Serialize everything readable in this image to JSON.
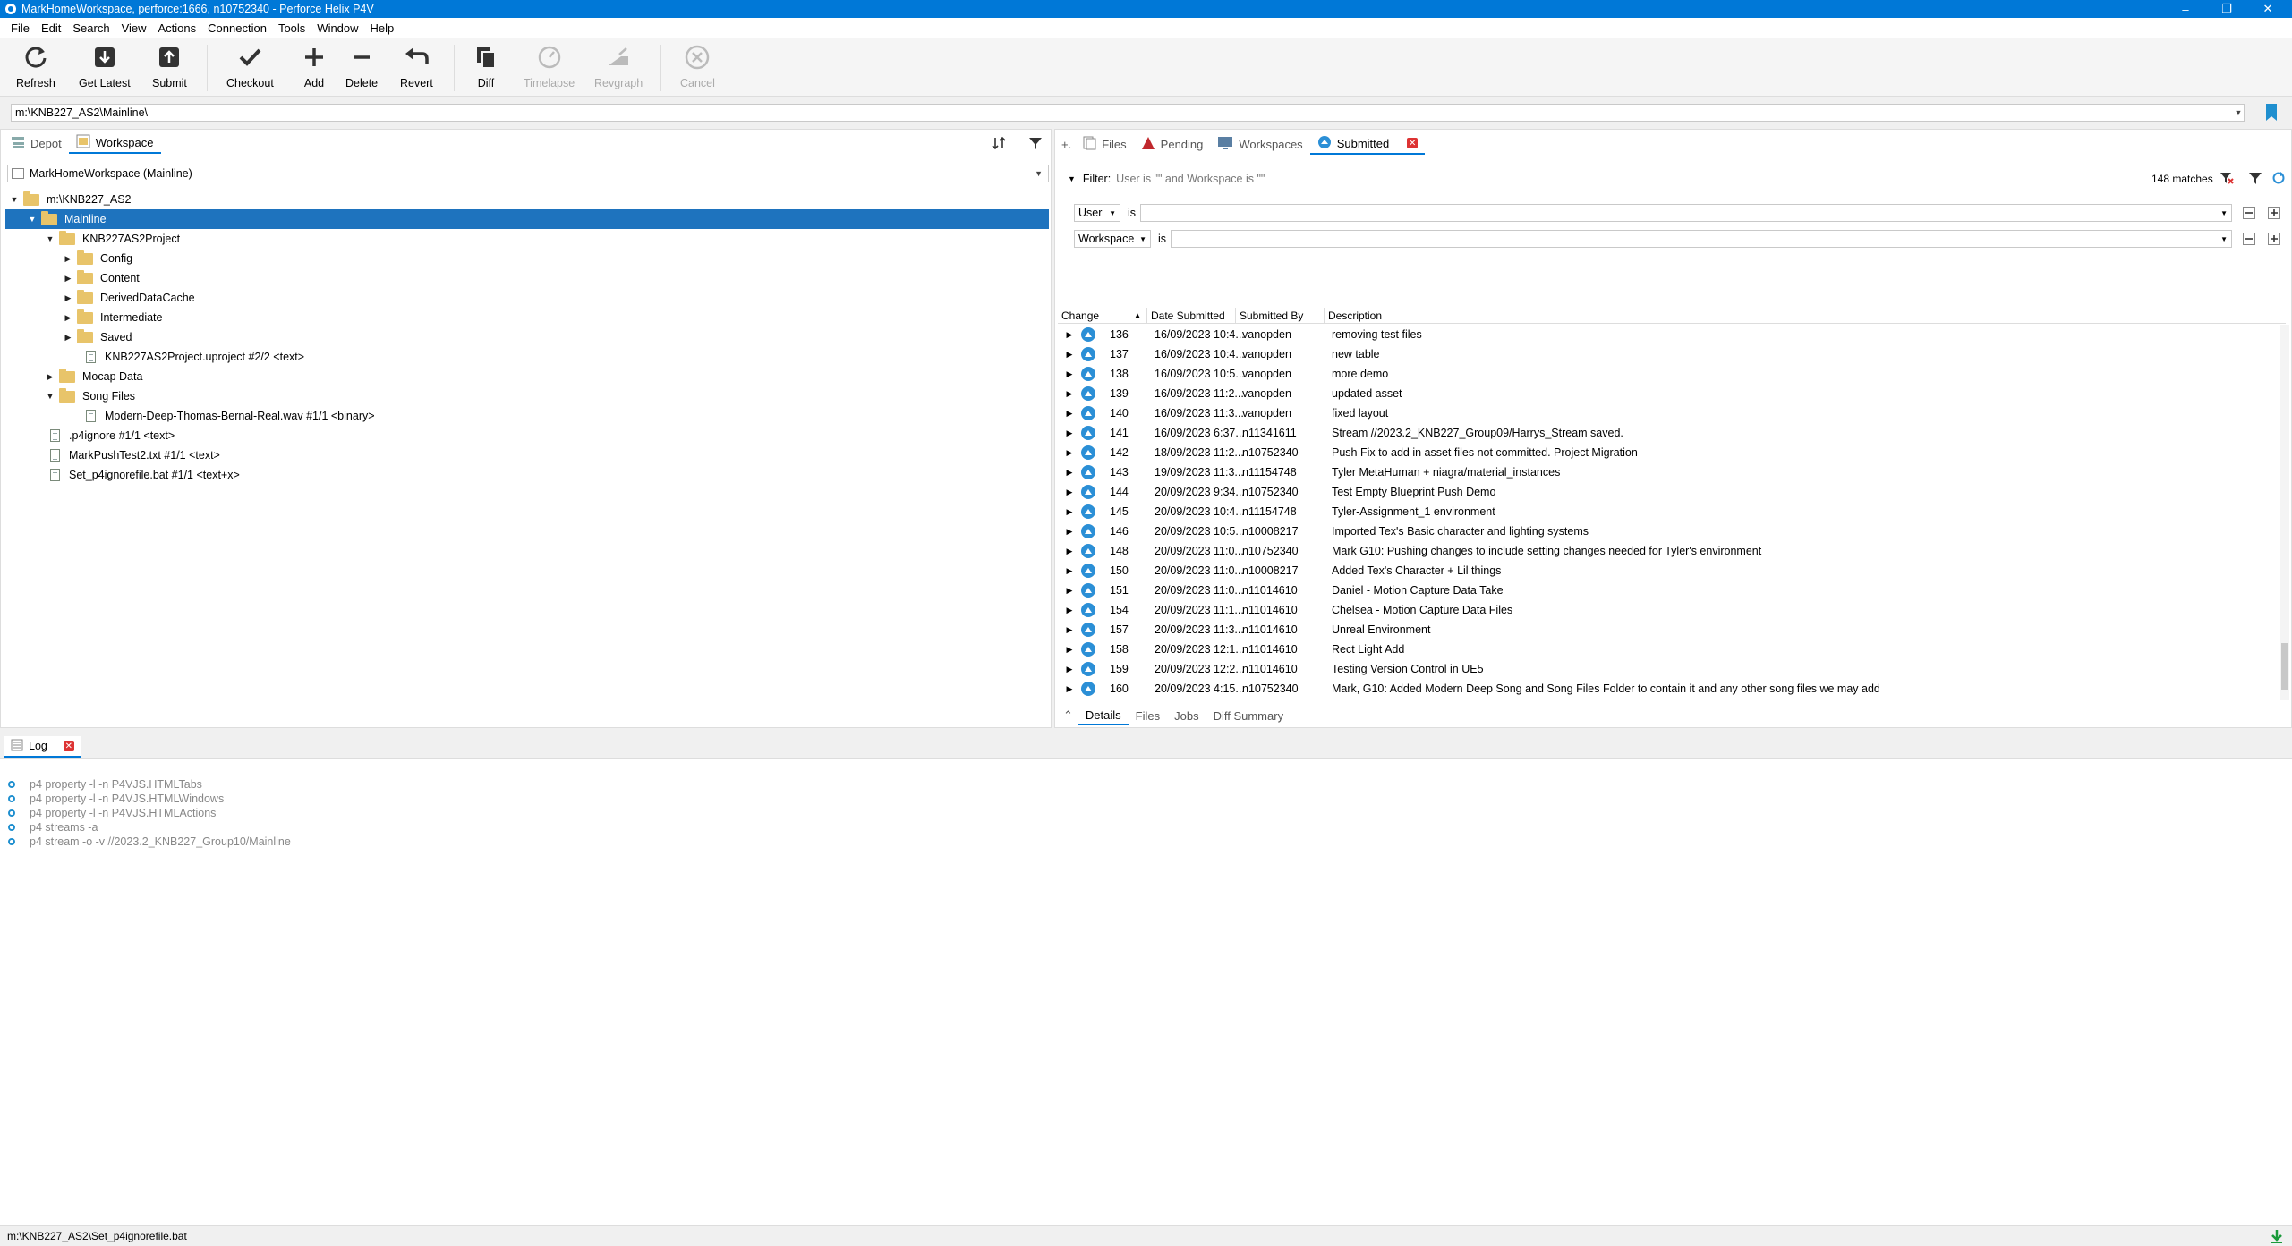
{
  "window": {
    "title": "MarkHomeWorkspace,  perforce:1666,  n10752340 - Perforce Helix P4V"
  },
  "menu": [
    "File",
    "Edit",
    "Search",
    "View",
    "Actions",
    "Connection",
    "Tools",
    "Window",
    "Help"
  ],
  "toolbar": {
    "refresh": "Refresh",
    "get_latest": "Get Latest",
    "submit": "Submit",
    "checkout": "Checkout",
    "add": "Add",
    "delete": "Delete",
    "revert": "Revert",
    "diff": "Diff",
    "timelapse": "Timelapse",
    "revgraph": "Revgraph",
    "cancel": "Cancel"
  },
  "path": "m:\\KNB227_AS2\\Mainline\\",
  "left": {
    "tabs": {
      "depot": "Depot",
      "workspace": "Workspace"
    },
    "workspace_combo": "MarkHomeWorkspace (Mainline)",
    "tree": {
      "root": "m:\\KNB227_AS2",
      "mainline": "Mainline",
      "project": "KNB227AS2Project",
      "config": "Config",
      "content": "Content",
      "ddc": "DerivedDataCache",
      "intermediate": "Intermediate",
      "saved": "Saved",
      "uproject": "KNB227AS2Project.uproject #2/2 <text>",
      "mocap": "Mocap Data",
      "songs": "Song Files",
      "wav": "Modern-Deep-Thomas-Bernal-Real.wav #1/1 <binary>",
      "p4ignore": ".p4ignore #1/1 <text>",
      "pushtest": "MarkPushTest2.txt #1/1 <text>",
      "setignore": "Set_p4ignorefile.bat #1/1 <text+x>"
    }
  },
  "right": {
    "tabs": {
      "files": "Files",
      "pending": "Pending",
      "workspaces": "Workspaces",
      "submitted": "Submitted"
    },
    "filter_label": "Filter:",
    "filter_summary": "User is \"\" and Workspace is \"\"",
    "matches": "148 matches",
    "filter_rows": [
      {
        "field": "User",
        "op": "is",
        "value": ""
      },
      {
        "field": "Workspace",
        "op": "is",
        "value": ""
      }
    ],
    "columns": {
      "change": "Change",
      "date": "Date Submitted",
      "by": "Submitted By",
      "desc": "Description"
    },
    "rows": [
      {
        "change": "136",
        "date": "16/09/2023 10:4...",
        "by": "vanopden",
        "desc": "removing test files"
      },
      {
        "change": "137",
        "date": "16/09/2023 10:4...",
        "by": "vanopden",
        "desc": "new table"
      },
      {
        "change": "138",
        "date": "16/09/2023 10:5...",
        "by": "vanopden",
        "desc": "more demo"
      },
      {
        "change": "139",
        "date": "16/09/2023 11:2...",
        "by": "vanopden",
        "desc": "updated asset"
      },
      {
        "change": "140",
        "date": "16/09/2023 11:3...",
        "by": "vanopden",
        "desc": "fixed layout"
      },
      {
        "change": "141",
        "date": "16/09/2023 6:37...",
        "by": "n11341611",
        "desc": "Stream //2023.2_KNB227_Group09/Harrys_Stream saved."
      },
      {
        "change": "142",
        "date": "18/09/2023 11:2...",
        "by": "n10752340",
        "desc": "Push Fix to add in asset files not committed. Project Migration"
      },
      {
        "change": "143",
        "date": "19/09/2023 11:3...",
        "by": "n11154748",
        "desc": "Tyler MetaHuman + niagra/material_instances"
      },
      {
        "change": "144",
        "date": "20/09/2023 9:34...",
        "by": "n10752340",
        "desc": "Test Empty Blueprint Push Demo"
      },
      {
        "change": "145",
        "date": "20/09/2023 10:4...",
        "by": "n11154748",
        "desc": "Tyler-Assignment_1 environment"
      },
      {
        "change": "146",
        "date": "20/09/2023 10:5...",
        "by": "n10008217",
        "desc": "Imported Tex's Basic character and lighting systems"
      },
      {
        "change": "148",
        "date": "20/09/2023 11:0...",
        "by": "n10752340",
        "desc": "Mark G10: Pushing changes to include setting changes needed for Tyler's environment"
      },
      {
        "change": "150",
        "date": "20/09/2023 11:0...",
        "by": "n10008217",
        "desc": "Added Tex's Character + Lil things"
      },
      {
        "change": "151",
        "date": "20/09/2023 11:0...",
        "by": "n11014610",
        "desc": "Daniel - Motion Capture Data Take"
      },
      {
        "change": "154",
        "date": "20/09/2023 11:1...",
        "by": "n11014610",
        "desc": "Chelsea - Motion Capture Data Files"
      },
      {
        "change": "157",
        "date": "20/09/2023 11:3...",
        "by": "n11014610",
        "desc": "Unreal Environment"
      },
      {
        "change": "158",
        "date": "20/09/2023 12:1...",
        "by": "n11014610",
        "desc": "Rect Light Add"
      },
      {
        "change": "159",
        "date": "20/09/2023 12:2...",
        "by": "n11014610",
        "desc": "Testing Version Control in UE5"
      },
      {
        "change": "160",
        "date": "20/09/2023 4:15...",
        "by": "n10752340",
        "desc": "Mark, G10: Added Modern Deep Song and Song Files Folder to contain it and any other song files we may add"
      }
    ],
    "bottom_tabs": {
      "details": "Details",
      "files": "Files",
      "jobs": "Jobs",
      "diff_summary": "Diff Summary"
    }
  },
  "log": {
    "tab": "Log",
    "lines": [
      "p4 property -l -n P4VJS.HTMLTabs",
      "p4 property -l -n P4VJS.HTMLWindows",
      "p4 property -l -n P4VJS.HTMLActions",
      "p4 streams -a",
      "p4 stream -o -v //2023.2_KNB227_Group10/Mainline"
    ]
  },
  "status": {
    "path": "m:\\KNB227_AS2\\Set_p4ignorefile.bat"
  },
  "colors": {
    "accent": "#0078d7",
    "selection": "#1e73be",
    "folder": "#e8c46a",
    "changelist": "#2b8fd6"
  }
}
